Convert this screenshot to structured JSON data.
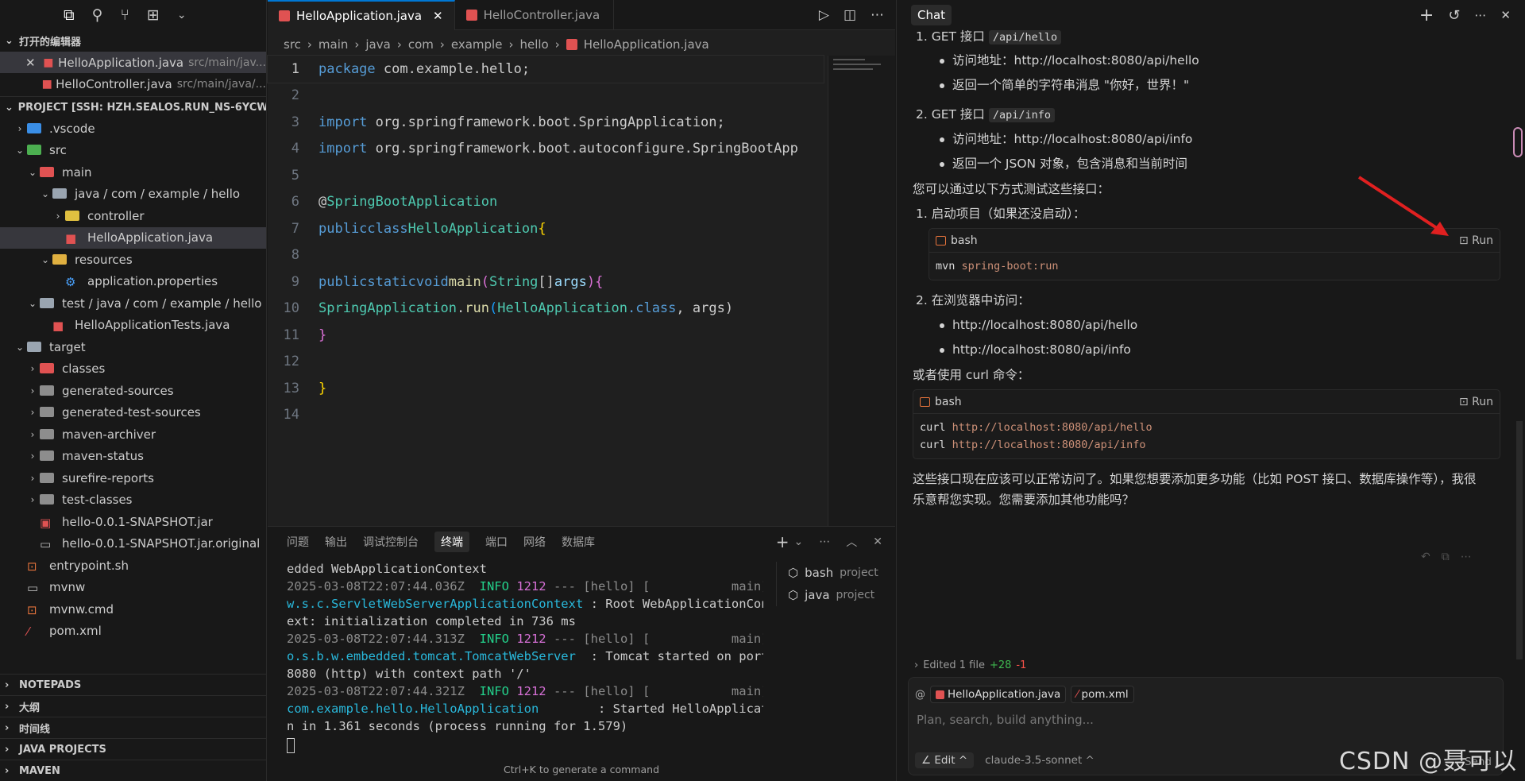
{
  "sidebar": {
    "open_editors_title": "打开的编辑器",
    "open_editors": [
      {
        "name": "HelloApplication.java",
        "path": "src/main/jav..."
      },
      {
        "name": "HelloController.java",
        "path": "src/main/java/..."
      }
    ],
    "project_title": "PROJECT [SSH: HZH.SEALOS.RUN_NS-6YCWS...",
    "tree": [
      {
        "label": ".vscode",
        "depth": 1,
        "icon": "vscode-folder-icon",
        "expand": ">"
      },
      {
        "label": "src",
        "depth": 1,
        "icon": "src-folder-icon",
        "expand": "v"
      },
      {
        "label": "main",
        "depth": 2,
        "icon": "main-folder-icon",
        "expand": "v"
      },
      {
        "label": "java / com / example / hello",
        "depth": 3,
        "icon": "folder-open-icon",
        "expand": "v"
      },
      {
        "label": "controller",
        "depth": 4,
        "icon": "controller-folder-icon",
        "expand": ">"
      },
      {
        "label": "HelloApplication.java",
        "depth": 4,
        "icon": "java-file-icon",
        "expand": "",
        "selected": true
      },
      {
        "label": "resources",
        "depth": 3,
        "icon": "resources-folder-icon",
        "expand": "v"
      },
      {
        "label": "application.properties",
        "depth": 4,
        "icon": "gear-icon",
        "expand": ""
      },
      {
        "label": "test / java / com / example / hello",
        "depth": 2,
        "icon": "folder-open-icon",
        "expand": "v"
      },
      {
        "label": "HelloApplicationTests.java",
        "depth": 3,
        "icon": "java-file-icon",
        "expand": ""
      },
      {
        "label": "target",
        "depth": 1,
        "icon": "target-folder-icon",
        "expand": "v"
      },
      {
        "label": "classes",
        "depth": 2,
        "icon": "classes-folder-icon",
        "expand": ">"
      },
      {
        "label": "generated-sources",
        "depth": 2,
        "icon": "folder-icon",
        "expand": ">"
      },
      {
        "label": "generated-test-sources",
        "depth": 2,
        "icon": "folder-icon",
        "expand": ">"
      },
      {
        "label": "maven-archiver",
        "depth": 2,
        "icon": "folder-icon",
        "expand": ">"
      },
      {
        "label": "maven-status",
        "depth": 2,
        "icon": "folder-icon",
        "expand": ">"
      },
      {
        "label": "surefire-reports",
        "depth": 2,
        "icon": "folder-icon",
        "expand": ">"
      },
      {
        "label": "test-classes",
        "depth": 2,
        "icon": "folder-icon",
        "expand": ">"
      },
      {
        "label": "hello-0.0.1-SNAPSHOT.jar",
        "depth": 2,
        "icon": "jar-file-icon",
        "expand": ""
      },
      {
        "label": "hello-0.0.1-SNAPSHOT.jar.original",
        "depth": 2,
        "icon": "file-icon",
        "expand": ""
      },
      {
        "label": "entrypoint.sh",
        "depth": 1,
        "icon": "shell-file-icon",
        "expand": ""
      },
      {
        "label": "mvnw",
        "depth": 1,
        "icon": "file-icon",
        "expand": ""
      },
      {
        "label": "mvnw.cmd",
        "depth": 1,
        "icon": "shell-file-icon",
        "expand": ""
      },
      {
        "label": "pom.xml",
        "depth": 1,
        "icon": "maven-file-icon",
        "expand": ""
      }
    ],
    "bottom_sections": [
      "NOTEPADS",
      "大纲",
      "时间线",
      "JAVA PROJECTS",
      "MAVEN"
    ]
  },
  "editor": {
    "tabs": [
      {
        "label": "HelloApplication.java",
        "active": true
      },
      {
        "label": "HelloController.java",
        "active": false
      }
    ],
    "breadcrumb": [
      "src",
      "main",
      "java",
      "com",
      "example",
      "hello",
      "HelloApplication.java"
    ],
    "line_numbers": [
      "1",
      "2",
      "3",
      "4",
      "5",
      "6",
      "7",
      "8",
      "9",
      "10",
      "11",
      "12",
      "13",
      "14"
    ],
    "code": {
      "l1_kw": "package",
      "l1_rest": " com.example.hello;",
      "l3_kw": "import",
      "l3_rest": " org.springframework.boot.SpringApplication;",
      "l4_kw": "import",
      "l4_rest": " org.springframework.boot.autoconfigure.SpringBootApp",
      "l6_at": "@",
      "l6_ann": "SpringBootApplication",
      "l7_kw1": "public",
      "l7_kw2": "class",
      "l7_type": "HelloApplication",
      "l7_brace": "{",
      "l9_kw1": "public",
      "l9_kw2": "static",
      "l9_kw3": "void",
      "l9_fn": "main",
      "l9_p1": "(",
      "l9_type": "String",
      "l9_arr": "[]",
      "l9_arg": "args",
      "l9_p2": ")",
      "l9_brace": "{",
      "l10_type": "SpringApplication",
      "l10_dot": ".",
      "l10_fn": "run",
      "l10_p": "(",
      "l10_t2": "HelloApplication",
      "l10_cls": ".class",
      "l10_rest": ", args)",
      "l11_brace": "}",
      "l13_brace": "}"
    }
  },
  "panel": {
    "tabs": [
      "问题",
      "输出",
      "调试控制台",
      "终端",
      "端口",
      "网络",
      "数据库"
    ],
    "active_tab": "终端",
    "terminal_lines": [
      {
        "parts": [
          [
            "pl",
            "edded WebApplicationContext"
          ]
        ]
      },
      {
        "parts": [
          [
            "grey",
            "2025-03-08T22:07:44.036Z  "
          ],
          [
            "info",
            "INFO "
          ],
          [
            "mag",
            "1212"
          ],
          [
            "grey",
            " --- [hello] [           main]"
          ]
        ]
      },
      {
        "parts": [
          [
            "cyan",
            "w.s.c.ServletWebServerApplicationContext"
          ],
          [
            "pl",
            " : Root WebApplicationCont"
          ]
        ]
      },
      {
        "parts": [
          [
            "pl",
            "ext: initialization completed in 736 ms"
          ]
        ]
      },
      {
        "parts": [
          [
            "grey",
            "2025-03-08T22:07:44.313Z  "
          ],
          [
            "info",
            "INFO "
          ],
          [
            "mag",
            "1212"
          ],
          [
            "grey",
            " --- [hello] [           main]"
          ]
        ]
      },
      {
        "parts": [
          [
            "cyan",
            "o.s.b.w.embedded.tomcat.TomcatWebServer "
          ],
          [
            "pl",
            " : Tomcat started on port"
          ]
        ]
      },
      {
        "parts": [
          [
            "pl",
            "8080 (http) with context path '/'"
          ]
        ]
      },
      {
        "parts": [
          [
            "grey",
            "2025-03-08T22:07:44.321Z  "
          ],
          [
            "info",
            "INFO "
          ],
          [
            "mag",
            "1212"
          ],
          [
            "grey",
            " --- [hello] [           main]"
          ]
        ]
      },
      {
        "parts": [
          [
            "cyan",
            "com.example.hello.HelloApplication       "
          ],
          [
            "pl",
            " : Started HelloApplicatio"
          ]
        ]
      },
      {
        "parts": [
          [
            "pl",
            "n in 1.361 seconds (process running for 1.579)"
          ]
        ]
      }
    ],
    "terminals": [
      {
        "name": "bash",
        "sub": "project"
      },
      {
        "name": "java",
        "sub": "project"
      }
    ],
    "hint": "Ctrl+K to generate a command"
  },
  "chat": {
    "tab": "Chat",
    "item1_prefix": "1. GET 接口 ",
    "item1_code": "/api/hello",
    "item1_bullets": [
      "访问地址：http://localhost:8080/api/hello",
      "返回一个简单的字符串消息 \"你好，世界！\""
    ],
    "item2_prefix": "2. GET 接口 ",
    "item2_code": "/api/info",
    "item2_bullets": [
      "访问地址：http://localhost:8080/api/info",
      "返回一个 JSON 对象，包含消息和当前时间"
    ],
    "test_intro": "您可以通过以下方式测试这些接口：",
    "step1": "1. 启动项目（如果还没启动）：",
    "block1": {
      "lang": "bash",
      "run": "Run",
      "cmd": "mvn",
      "arg": "spring-boot:run"
    },
    "step2": "2. 在浏览器中访问：",
    "urls": [
      "http://localhost:8080/api/hello",
      "http://localhost:8080/api/info"
    ],
    "curl_intro": "或者使用 curl 命令：",
    "block2": {
      "lang": "bash",
      "run": "Run",
      "lines": [
        [
          "curl",
          "http://localhost:8080/api/hello"
        ],
        [
          "curl",
          "http://localhost:8080/api/info"
        ]
      ]
    },
    "closing_1": "这些接口现在应该可以正常访问了。如果您想要添加更多功能（比如 POST 接口、数据库操作等），我很",
    "closing_2": "乐意帮您实现。您需要添加其他功能吗？",
    "edited_summary": "Edited 1 file",
    "edited_add": "+28",
    "edited_del": "-1",
    "context_files": [
      "HelloApplication.java",
      "pom.xml"
    ],
    "input_placeholder": "Plan, search, build anything...",
    "mode": "Edit",
    "model": "claude-3.5-sonnet",
    "send": "Send",
    "watermark": "CSDN @聂可以"
  }
}
